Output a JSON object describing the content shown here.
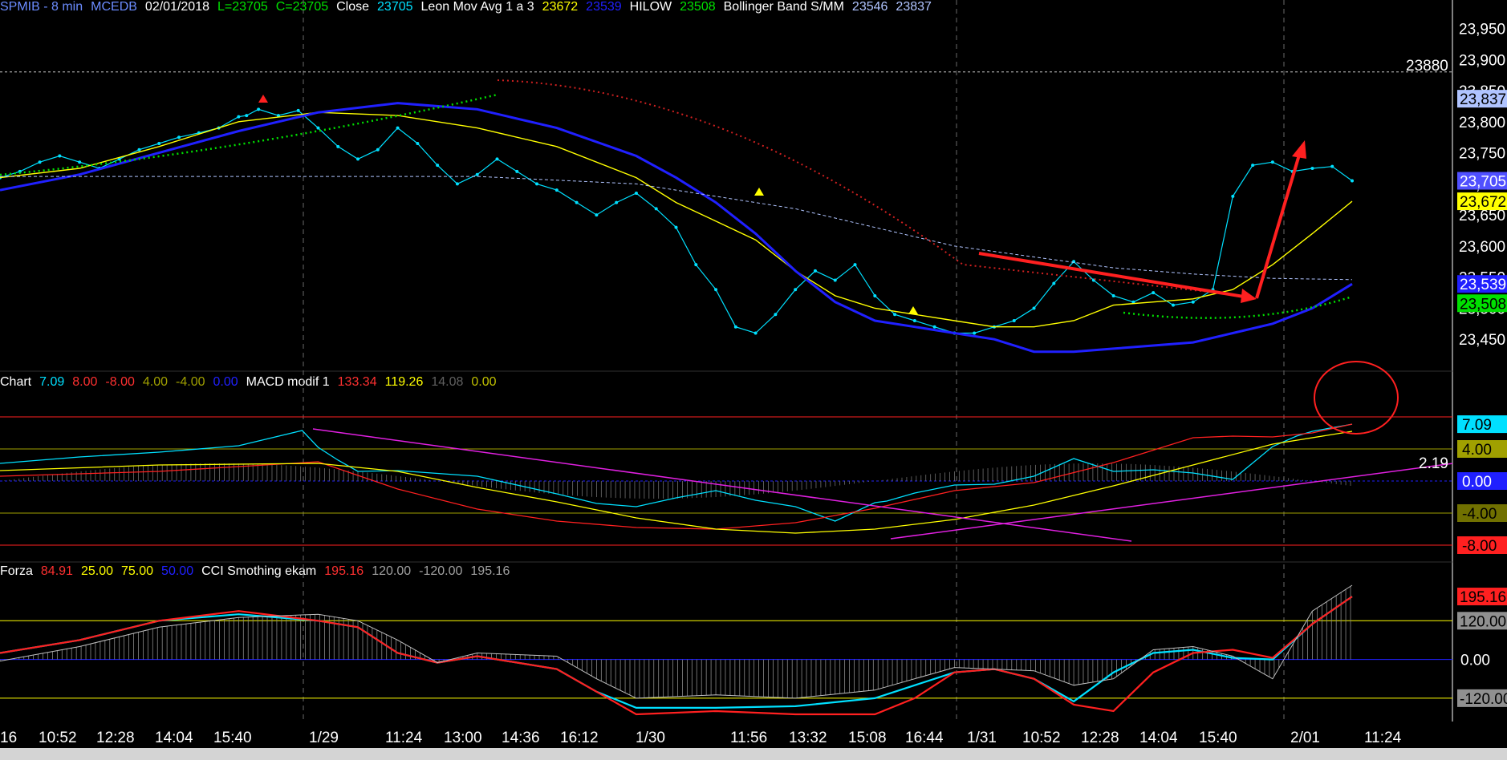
{
  "header_main": [
    {
      "text": "SPMIB - 8 min",
      "color": "#6b8cff"
    },
    {
      "text": "MCEDB",
      "color": "#6b8cff"
    },
    {
      "text": "02/01/2018",
      "color": "#ffffff"
    },
    {
      "text": "L=23705",
      "color": "#00e000"
    },
    {
      "text": "C=23705",
      "color": "#00e000"
    },
    {
      "text": "Close",
      "color": "#ffffff"
    },
    {
      "text": "23705",
      "color": "#00e0ff"
    },
    {
      "text": "Leon Mov Avg 1 a 3",
      "color": "#ffffff"
    },
    {
      "text": "23672",
      "color": "#ffff00"
    },
    {
      "text": "23539",
      "color": "#2020ff"
    },
    {
      "text": "HILOW",
      "color": "#ffffff"
    },
    {
      "text": "23508",
      "color": "#00e000"
    },
    {
      "text": "Bollinger Band S/MM",
      "color": "#ffffff"
    },
    {
      "text": "23546",
      "color": "#b0c4ff"
    },
    {
      "text": "23837",
      "color": "#b0c4ff"
    }
  ],
  "header_macd": [
    {
      "text": "Chart",
      "color": "#ffffff"
    },
    {
      "text": "7.09",
      "color": "#00e0ff"
    },
    {
      "text": "8.00",
      "color": "#ff3030"
    },
    {
      "text": "-8.00",
      "color": "#ff3030"
    },
    {
      "text": "4.00",
      "color": "#a0a000"
    },
    {
      "text": "-4.00",
      "color": "#a0a000"
    },
    {
      "text": "0.00",
      "color": "#2020ff"
    },
    {
      "text": "MACD modif 1",
      "color": "#ffffff"
    },
    {
      "text": "133.34",
      "color": "#ff3030"
    },
    {
      "text": "119.26",
      "color": "#ffff00"
    },
    {
      "text": "14.08",
      "color": "#606060"
    },
    {
      "text": "0.00",
      "color": "#c0c000"
    }
  ],
  "header_cci": [
    {
      "text": "Forza",
      "color": "#ffffff"
    },
    {
      "text": "84.91",
      "color": "#ff3030"
    },
    {
      "text": "25.00",
      "color": "#ffff00"
    },
    {
      "text": "75.00",
      "color": "#ffff00"
    },
    {
      "text": "50.00",
      "color": "#2020ff"
    },
    {
      "text": "CCI Smothing ekam",
      "color": "#ffffff"
    },
    {
      "text": "195.16",
      "color": "#ff3030"
    },
    {
      "text": "120.00",
      "color": "#a0a0a0"
    },
    {
      "text": "-120.00",
      "color": "#a0a0a0"
    },
    {
      "text": "195.16",
      "color": "#a0a0a0"
    }
  ],
  "colors": {
    "close": "#00e0ff",
    "avg_fast": "#ffff00",
    "avg_slow": "#2020ff",
    "hilow": "#00e000",
    "bollinger": "#b0c4ff",
    "annotation": "#ff2020",
    "trendline": "#e020e0",
    "grid": "#4a6a6a"
  },
  "chart_data": [
    {
      "type": "line",
      "title": "SPMIB - 8 min",
      "x_tick_labels": [
        "16",
        "10:52",
        "12:28",
        "14:04",
        "15:40",
        "1/29",
        "11:24",
        "13:00",
        "14:36",
        "16:12",
        "1/30",
        "11:56",
        "13:32",
        "15:08",
        "16:44",
        "1/31",
        "10:52",
        "12:28",
        "14:04",
        "15:40",
        "2/01",
        "11:24"
      ],
      "y_tick_labels": [
        "23,950",
        "23,900",
        "23,850",
        "23,800",
        "23,750",
        "23,700",
        "23,650",
        "23,600",
        "23,550",
        "23,500",
        "23,450"
      ],
      "ylim": [
        23400,
        23970
      ],
      "reference_line": 23880,
      "price_badges": [
        {
          "text": "23,837",
          "value": 23837,
          "bg": "#b0c4ff",
          "fg": "#000000"
        },
        {
          "text": "23,705",
          "value": 23705,
          "bg": "#5050ff",
          "fg": "#ffffff"
        },
        {
          "text": "23,672",
          "value": 23672,
          "bg": "#ffff00",
          "fg": "#000000"
        },
        {
          "text": "23,539",
          "value": 23539,
          "bg": "#2020ff",
          "fg": "#ffffff"
        },
        {
          "text": "23,508",
          "value": 23508,
          "bg": "#00e000",
          "fg": "#000000"
        }
      ],
      "reference_label": "23880",
      "series": [
        {
          "key": "close",
          "x": [
            0,
            5,
            10,
            15,
            20,
            25,
            30,
            35,
            40,
            45,
            50,
            55,
            60,
            62,
            65,
            70,
            75,
            80,
            85,
            90,
            95,
            100,
            105,
            110,
            115,
            120,
            125,
            130,
            135,
            140,
            145,
            150,
            155,
            160,
            165,
            170,
            175,
            180,
            185,
            190,
            195,
            200,
            205,
            210,
            215,
            220,
            225,
            230,
            235,
            240,
            245,
            250,
            255,
            260,
            265,
            270,
            275,
            280,
            285,
            290,
            295,
            300,
            305,
            310,
            315,
            320,
            325,
            330,
            335,
            340
          ],
          "y": [
            23710,
            23720,
            23735,
            23745,
            23735,
            23725,
            23740,
            23755,
            23765,
            23775,
            23782,
            23790,
            23808,
            23810,
            23820,
            23810,
            23818,
            23790,
            23760,
            23740,
            23755,
            23790,
            23765,
            23730,
            23700,
            23715,
            23740,
            23720,
            23700,
            23690,
            23670,
            23650,
            23670,
            23685,
            23660,
            23630,
            23570,
            23530,
            23470,
            23460,
            23490,
            23530,
            23560,
            23545,
            23570,
            23520,
            23490,
            23480,
            23470,
            23460,
            23460,
            23470,
            23480,
            23500,
            23540,
            23575,
            23545,
            23520,
            23510,
            23525,
            23505,
            23510,
            23530,
            23680,
            23730,
            23735,
            23720,
            23725,
            23728,
            23705
          ]
        },
        {
          "key": "avg_fast",
          "x": [
            0,
            20,
            40,
            60,
            80,
            100,
            120,
            140,
            160,
            170,
            180,
            190,
            200,
            210,
            220,
            230,
            240,
            250,
            260,
            270,
            280,
            290,
            300,
            310,
            320,
            330,
            340
          ],
          "y": [
            23710,
            23725,
            23760,
            23800,
            23815,
            23810,
            23790,
            23760,
            23710,
            23670,
            23640,
            23610,
            23560,
            23520,
            23500,
            23490,
            23480,
            23470,
            23470,
            23480,
            23505,
            23510,
            23515,
            23530,
            23570,
            23620,
            23672
          ]
        },
        {
          "key": "avg_slow",
          "x": [
            0,
            20,
            40,
            60,
            80,
            100,
            120,
            140,
            160,
            170,
            180,
            190,
            200,
            210,
            220,
            230,
            240,
            250,
            260,
            270,
            280,
            290,
            300,
            310,
            320,
            330,
            340
          ],
          "y": [
            23690,
            23715,
            23750,
            23785,
            23815,
            23830,
            23820,
            23790,
            23745,
            23710,
            23670,
            23620,
            23560,
            23510,
            23480,
            23470,
            23460,
            23450,
            23430,
            23430,
            23435,
            23440,
            23445,
            23460,
            23475,
            23500,
            23539
          ]
        },
        {
          "key": "bollinger",
          "x": [
            0,
            60,
            120,
            160,
            200,
            240,
            280,
            300,
            320,
            340
          ],
          "y": [
            23712,
            23712,
            23712,
            23700,
            23660,
            23600,
            23565,
            23555,
            23548,
            23546
          ]
        }
      ]
    },
    {
      "type": "line",
      "title": "MACD modif 1",
      "y_tick_labels": [
        "7.09",
        "4.00",
        "0.00",
        "-4.00",
        "-8.00"
      ],
      "ylim": [
        -10,
        11
      ],
      "reference_label": "2.19",
      "levels": [
        8.0,
        4.0,
        0.0,
        -4.0,
        -8.0
      ],
      "badges": [
        {
          "text": "7.09",
          "value": 7.09,
          "bg": "#00e0ff",
          "fg": "#000000"
        },
        {
          "text": "4.00",
          "value": 4.0,
          "bg": "#a0a000",
          "fg": "#000000"
        },
        {
          "text": "0.00",
          "value": 0.0,
          "bg": "#2020ff",
          "fg": "#ffffff"
        },
        {
          "text": "-4.00",
          "value": -4.0,
          "bg": "#707000",
          "fg": "#000000"
        },
        {
          "text": "-8.00",
          "value": -8.0,
          "bg": "#ff2020",
          "fg": "#000000"
        }
      ],
      "series": [
        {
          "key": "cyan",
          "x": [
            0,
            20,
            40,
            60,
            76,
            80,
            85,
            90,
            100,
            120,
            140,
            150,
            160,
            170,
            180,
            190,
            200,
            210,
            220,
            223,
            230,
            240,
            250,
            260,
            270,
            280,
            290,
            300,
            310,
            320,
            326,
            330,
            340
          ],
          "y": [
            2.2,
            3.0,
            3.6,
            4.4,
            6.3,
            4.2,
            2.6,
            1.2,
            1.3,
            0.6,
            -1.6,
            -2.8,
            -3.2,
            -2.1,
            -1.2,
            -2.4,
            -3.2,
            -5.0,
            -2.7,
            -2.5,
            -1.5,
            -0.5,
            -0.4,
            0.6,
            2.8,
            1.2,
            1.4,
            1.0,
            0.2,
            4.3,
            5.6,
            6.2,
            7.09
          ]
        },
        {
          "key": "red",
          "x": [
            0,
            40,
            80,
            100,
            120,
            140,
            160,
            180,
            200,
            220,
            240,
            260,
            280,
            300,
            310,
            320,
            330,
            340
          ],
          "y": [
            0.6,
            1.2,
            2.4,
            -1.0,
            -3.5,
            -5.0,
            -5.8,
            -6.0,
            -5.2,
            -3.4,
            -1.2,
            -0.2,
            2.3,
            5.4,
            5.6,
            5.5,
            6.0,
            7.1
          ]
        },
        {
          "key": "yellow",
          "x": [
            0,
            40,
            80,
            100,
            120,
            140,
            160,
            180,
            200,
            220,
            240,
            260,
            280,
            300,
            320,
            340
          ],
          "y": [
            1.3,
            2.0,
            2.2,
            1.2,
            -0.8,
            -2.6,
            -4.6,
            -6.0,
            -6.5,
            -6.0,
            -4.8,
            -3.0,
            -0.6,
            2.0,
            4.6,
            6.2
          ]
        }
      ]
    },
    {
      "type": "line",
      "title": "CCI Smothing ekam",
      "y_tick_labels": [
        "195.16",
        "120.00",
        "0.00",
        "-120.00"
      ],
      "ylim": [
        -180,
        240
      ],
      "levels": [
        120,
        -120
      ],
      "badges": [
        {
          "text": "195.16",
          "value": 195.16,
          "bg": "#ff2020",
          "fg": "#000000"
        },
        {
          "text": "120.00",
          "value": 120,
          "bg": "#909090",
          "fg": "#000000"
        },
        {
          "text": "-120.00",
          "value": -120,
          "bg": "#909090",
          "fg": "#000000"
        }
      ],
      "series": [
        {
          "key": "cyan",
          "x": [
            0,
            20,
            40,
            60,
            80,
            90,
            100,
            110,
            120,
            140,
            150,
            160,
            180,
            200,
            220,
            240,
            250,
            260,
            270,
            280,
            290,
            300,
            310,
            320,
            330,
            340
          ],
          "y": [
            20,
            60,
            120,
            140,
            120,
            100,
            20,
            -10,
            10,
            -30,
            -100,
            -150,
            -150,
            -145,
            -120,
            -40,
            -30,
            -60,
            -130,
            -40,
            20,
            30,
            5,
            0,
            110,
            195
          ]
        },
        {
          "key": "red",
          "x": [
            0,
            20,
            40,
            60,
            80,
            90,
            100,
            110,
            120,
            140,
            150,
            160,
            180,
            200,
            220,
            230,
            240,
            250,
            260,
            270,
            280,
            290,
            300,
            310,
            320,
            330,
            340
          ],
          "y": [
            20,
            60,
            120,
            150,
            120,
            100,
            20,
            -10,
            10,
            -30,
            -100,
            -170,
            -160,
            -170,
            -170,
            -120,
            -40,
            -30,
            -60,
            -140,
            -160,
            -40,
            20,
            30,
            5,
            110,
            195
          ]
        },
        {
          "key": "gray",
          "x": [
            0,
            20,
            40,
            60,
            80,
            90,
            100,
            110,
            120,
            140,
            150,
            160,
            180,
            200,
            220,
            240,
            260,
            270,
            280,
            290,
            300,
            310,
            320,
            330,
            340
          ],
          "y": [
            -5,
            40,
            100,
            130,
            140,
            120,
            60,
            -10,
            20,
            10,
            -60,
            -120,
            -110,
            -120,
            -95,
            -25,
            -35,
            -80,
            -60,
            30,
            40,
            10,
            -60,
            150,
            230
          ]
        }
      ]
    }
  ]
}
